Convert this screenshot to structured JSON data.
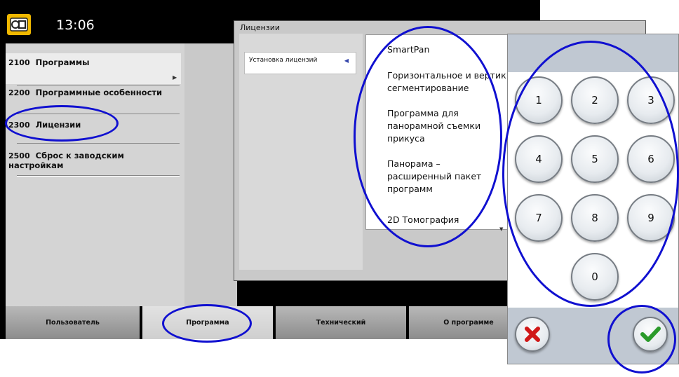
{
  "header": {
    "clock": "13:06",
    "logo_icon": "device-logo-icon"
  },
  "menu": {
    "items": [
      {
        "num": "2100",
        "label": "Программы"
      },
      {
        "num": "2200",
        "label": "Программные особенности"
      },
      {
        "num": "2300",
        "label": "Лицензии"
      },
      {
        "num": "2500",
        "label": "Сброс к заводским настройкам"
      }
    ]
  },
  "tabs": [
    {
      "label": "Пользователь"
    },
    {
      "label": "Программа"
    },
    {
      "label": "Технический"
    },
    {
      "label": "О программе"
    }
  ],
  "licenses": {
    "title": "Лицензии",
    "submenu_item": "Установка лицензий",
    "entries": [
      "SmartPan",
      "Горизонтальное и вертик",
      "сегментирование",
      "Программа для",
      "панорамной съемки",
      "прикуса",
      "Панорама –",
      "расширенный пакет",
      "программ",
      "2D Томография"
    ]
  },
  "keypad": {
    "keys": [
      "1",
      "2",
      "3",
      "4",
      "5",
      "6",
      "7",
      "8",
      "9",
      "0"
    ],
    "cancel_icon": "cancel-x-icon",
    "confirm_icon": "checkmark-icon"
  },
  "colors": {
    "annotation": "#1010d0",
    "logo": "#f0b800",
    "cancel": "#d01818",
    "confirm": "#2a9a2a"
  }
}
